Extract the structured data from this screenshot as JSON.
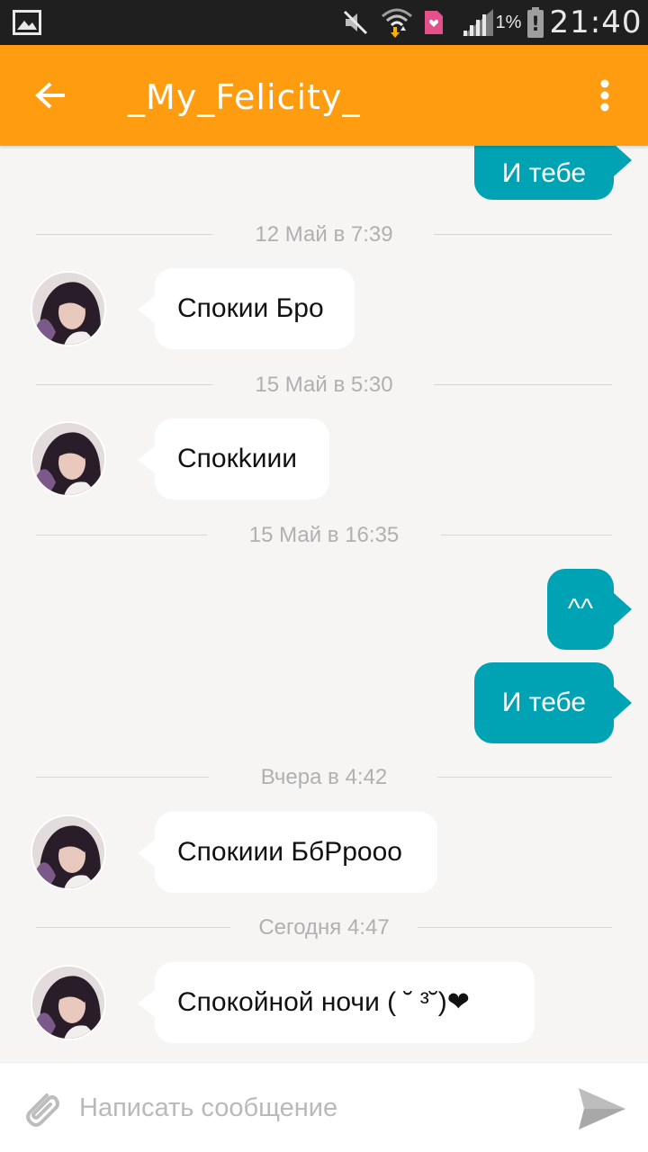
{
  "status_bar": {
    "battery_percent": "1%",
    "battery_alert": "!",
    "time": "21:40",
    "icons": [
      "gallery-icon",
      "mute-icon",
      "wifi-icon",
      "sim-icon",
      "signal-icon",
      "battery-icon"
    ]
  },
  "header": {
    "title": "_My_Felicity_",
    "back_icon": "arrow-left-icon",
    "menu_icon": "more-vertical-icon"
  },
  "messages": {
    "items": [
      {
        "kind": "out",
        "text": "И тебе"
      },
      {
        "kind": "divider",
        "text": "12 Май в 7:39"
      },
      {
        "kind": "in",
        "text": "Спокии Бро"
      },
      {
        "kind": "divider",
        "text": "15 Май в 5:30"
      },
      {
        "kind": "in",
        "text": "Спокkиии"
      },
      {
        "kind": "divider",
        "text": "15 Май в 16:35"
      },
      {
        "kind": "out",
        "text": "^^"
      },
      {
        "kind": "out",
        "text": "И тебе"
      },
      {
        "kind": "divider",
        "text": "Вчера в 4:42"
      },
      {
        "kind": "in",
        "text": "Спокиии БбРрооо"
      },
      {
        "kind": "divider",
        "text": "Сегодня 4:47"
      },
      {
        "kind": "in",
        "text": "Спокойной ночи ( ˘ ³˘)❤"
      }
    ]
  },
  "composer": {
    "placeholder": "Написать сообщение",
    "value": "",
    "attach_icon": "paperclip-icon",
    "send_icon": "send-icon"
  },
  "colors": {
    "accent": "#ff9c10",
    "outgoing_bubble": "#00a3b4",
    "incoming_bubble": "#ffffff",
    "background": "#f6f5f3"
  }
}
